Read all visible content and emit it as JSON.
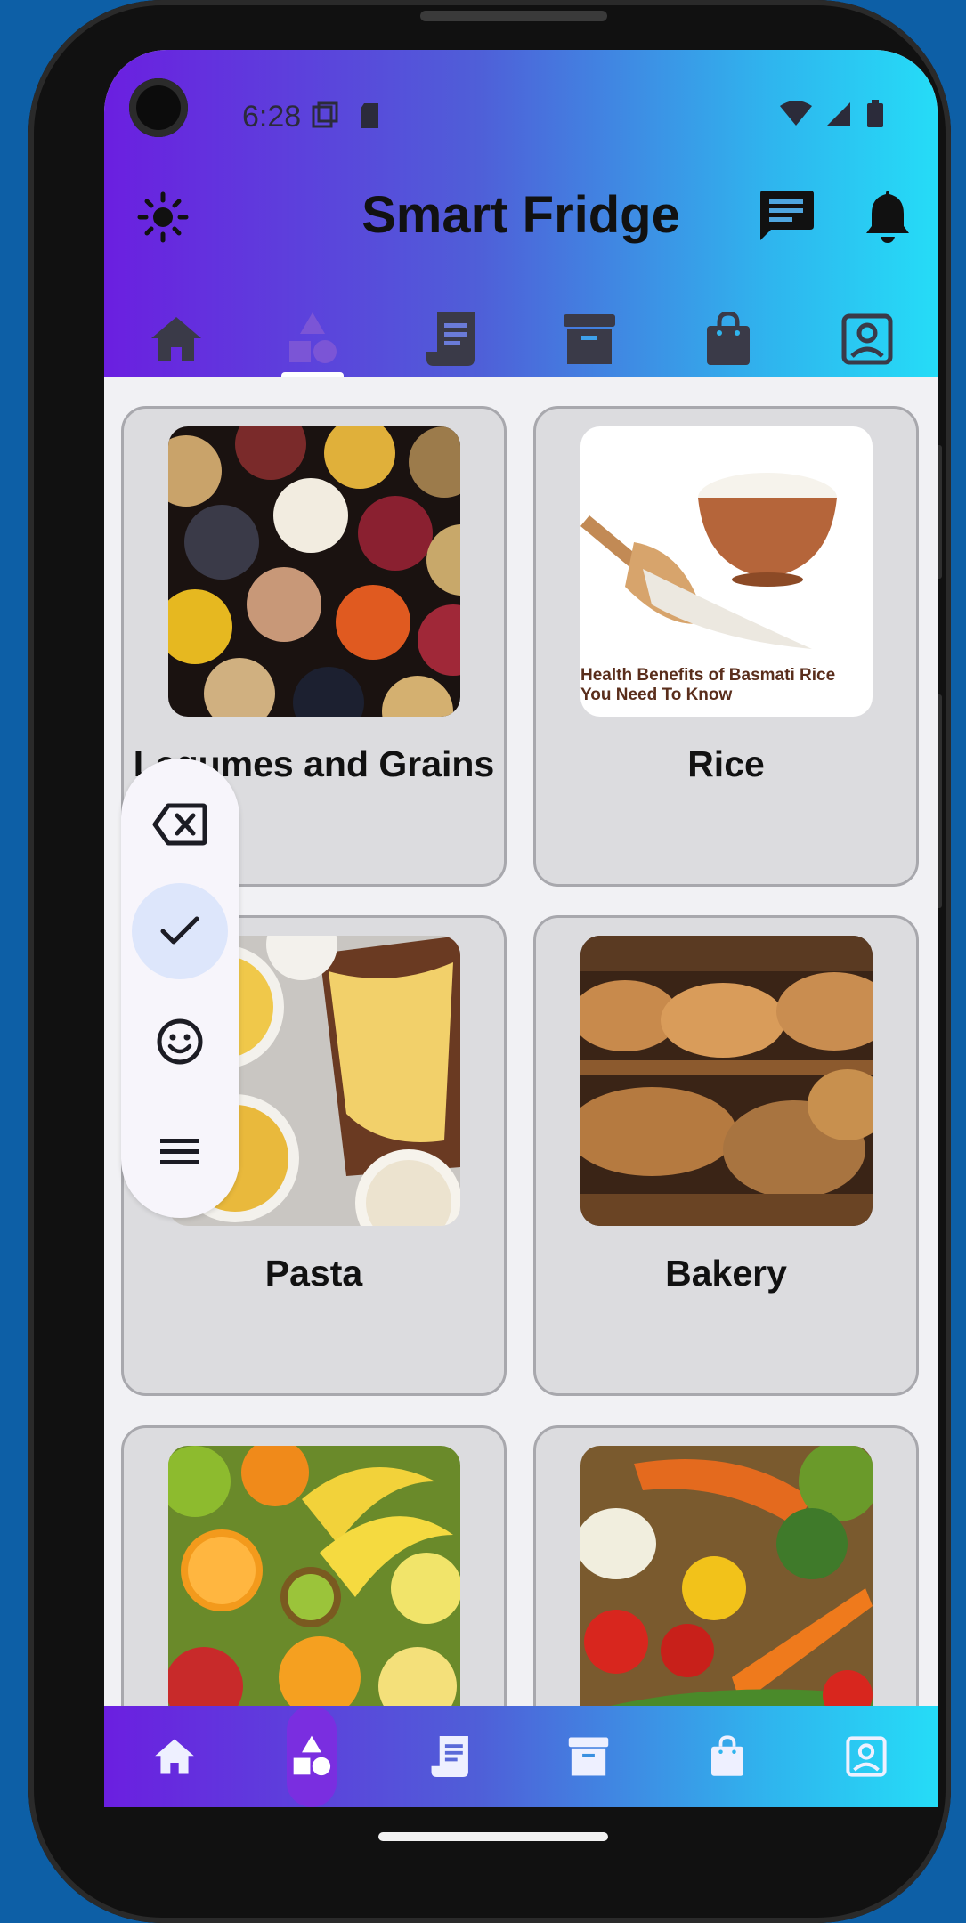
{
  "status_bar": {
    "time": "6:28"
  },
  "app_bar": {
    "title": "Smart Fridge"
  },
  "top_tabs": [
    "home",
    "categories",
    "recipes",
    "inventory",
    "shopping",
    "profile"
  ],
  "categories": [
    {
      "label": "Legumes and Grains",
      "image": "legumes-grains-photo"
    },
    {
      "label": "Rice",
      "image": "basmati-rice-photo",
      "image_caption": "Health Benefits of Basmati Rice You Need To Know"
    },
    {
      "label": "Pasta",
      "image": "pasta-photo"
    },
    {
      "label": "Bakery",
      "image": "bakery-bread-photo"
    },
    {
      "label": "",
      "image": "fruits-photo"
    },
    {
      "label": "",
      "image": "vegetables-photo"
    }
  ],
  "rail": [
    "backspace",
    "check",
    "emoji",
    "menu"
  ],
  "colors": {
    "gradient_start": "#6b1fe0",
    "gradient_end": "#25dcf7",
    "card_bg": "#dcdcdf",
    "rail_active": "#dde6fb"
  }
}
